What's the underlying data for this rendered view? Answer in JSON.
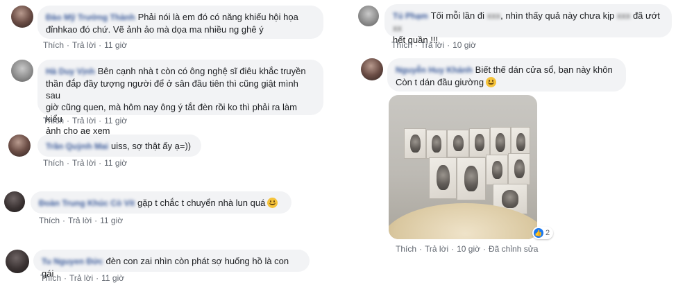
{
  "left_column": [
    {
      "author": "Đào Mỹ Trường Thành",
      "text": "Phải nói là em đó có năng khiếu hội họa\nđỉnhkao đó chứ. Vẽ ảnh ảo mà dọa ma nhiều ng ghê ý",
      "like": "Thích",
      "reply": "Trả lời",
      "time": "11 giờ"
    },
    {
      "author": "Hà Duy Vịnh",
      "text": "Bên cạnh nhà t còn có ông nghệ sĩ điêu khắc truyền\nthần đắp đầy tượng người để ở sân đầu tiên thì cũng giật mình sau\ngiờ cũng quen, mà hôm nay ông ý tắt đèn rồi ko thì phải ra làm kiểu\nảnh cho ae xem",
      "like": "Thích",
      "reply": "Trả lời",
      "time": "11 giờ"
    },
    {
      "author": "Trần Quỳnh Mai",
      "text": "uiss, sợ thật ấy ạ=))",
      "like": "Thích",
      "reply": "Trả lời",
      "time": "11 giờ"
    },
    {
      "author": "Đoàn Trung Khúc Cò Vít",
      "text": "gặp t chắc t chuyển nhà lun quá",
      "like": "Thích",
      "reply": "Trả lời",
      "time": "11 giờ"
    },
    {
      "author": "Tu Nguyen Đức",
      "text": "đèn con zai nhìn còn phát sợ huống hồ là con gái",
      "like": "Thích",
      "reply": "Trả lời",
      "time": "11 giờ"
    }
  ],
  "right_column": [
    {
      "author": "Tú Phạm",
      "text_a": "Tối mỗi lần đi",
      "text_b": ", nhìn thấy quả này chưa kịp",
      "text_c": "đã ướt",
      "text_d": "hết quần !!!",
      "like": "Thích",
      "reply": "Trả lời",
      "time": "10 giờ"
    },
    {
      "author": "Nguyễn Huy Khánh",
      "text": "Biết thế dán cửa sổ, bạn này khôn\nCòn t dán đầu giường",
      "reaction_count": "2",
      "like": "Thích",
      "reply": "Trả lời",
      "time": "10 giờ",
      "edited": "Đã chỉnh sửa"
    }
  ],
  "icons": {
    "emoji": "smile-emoji-icon",
    "like": "like-thumb-icon"
  },
  "colors": {
    "bubble": "#f2f3f5",
    "author": "#385898",
    "meta": "#616770",
    "like_blue": "#1877f2"
  }
}
